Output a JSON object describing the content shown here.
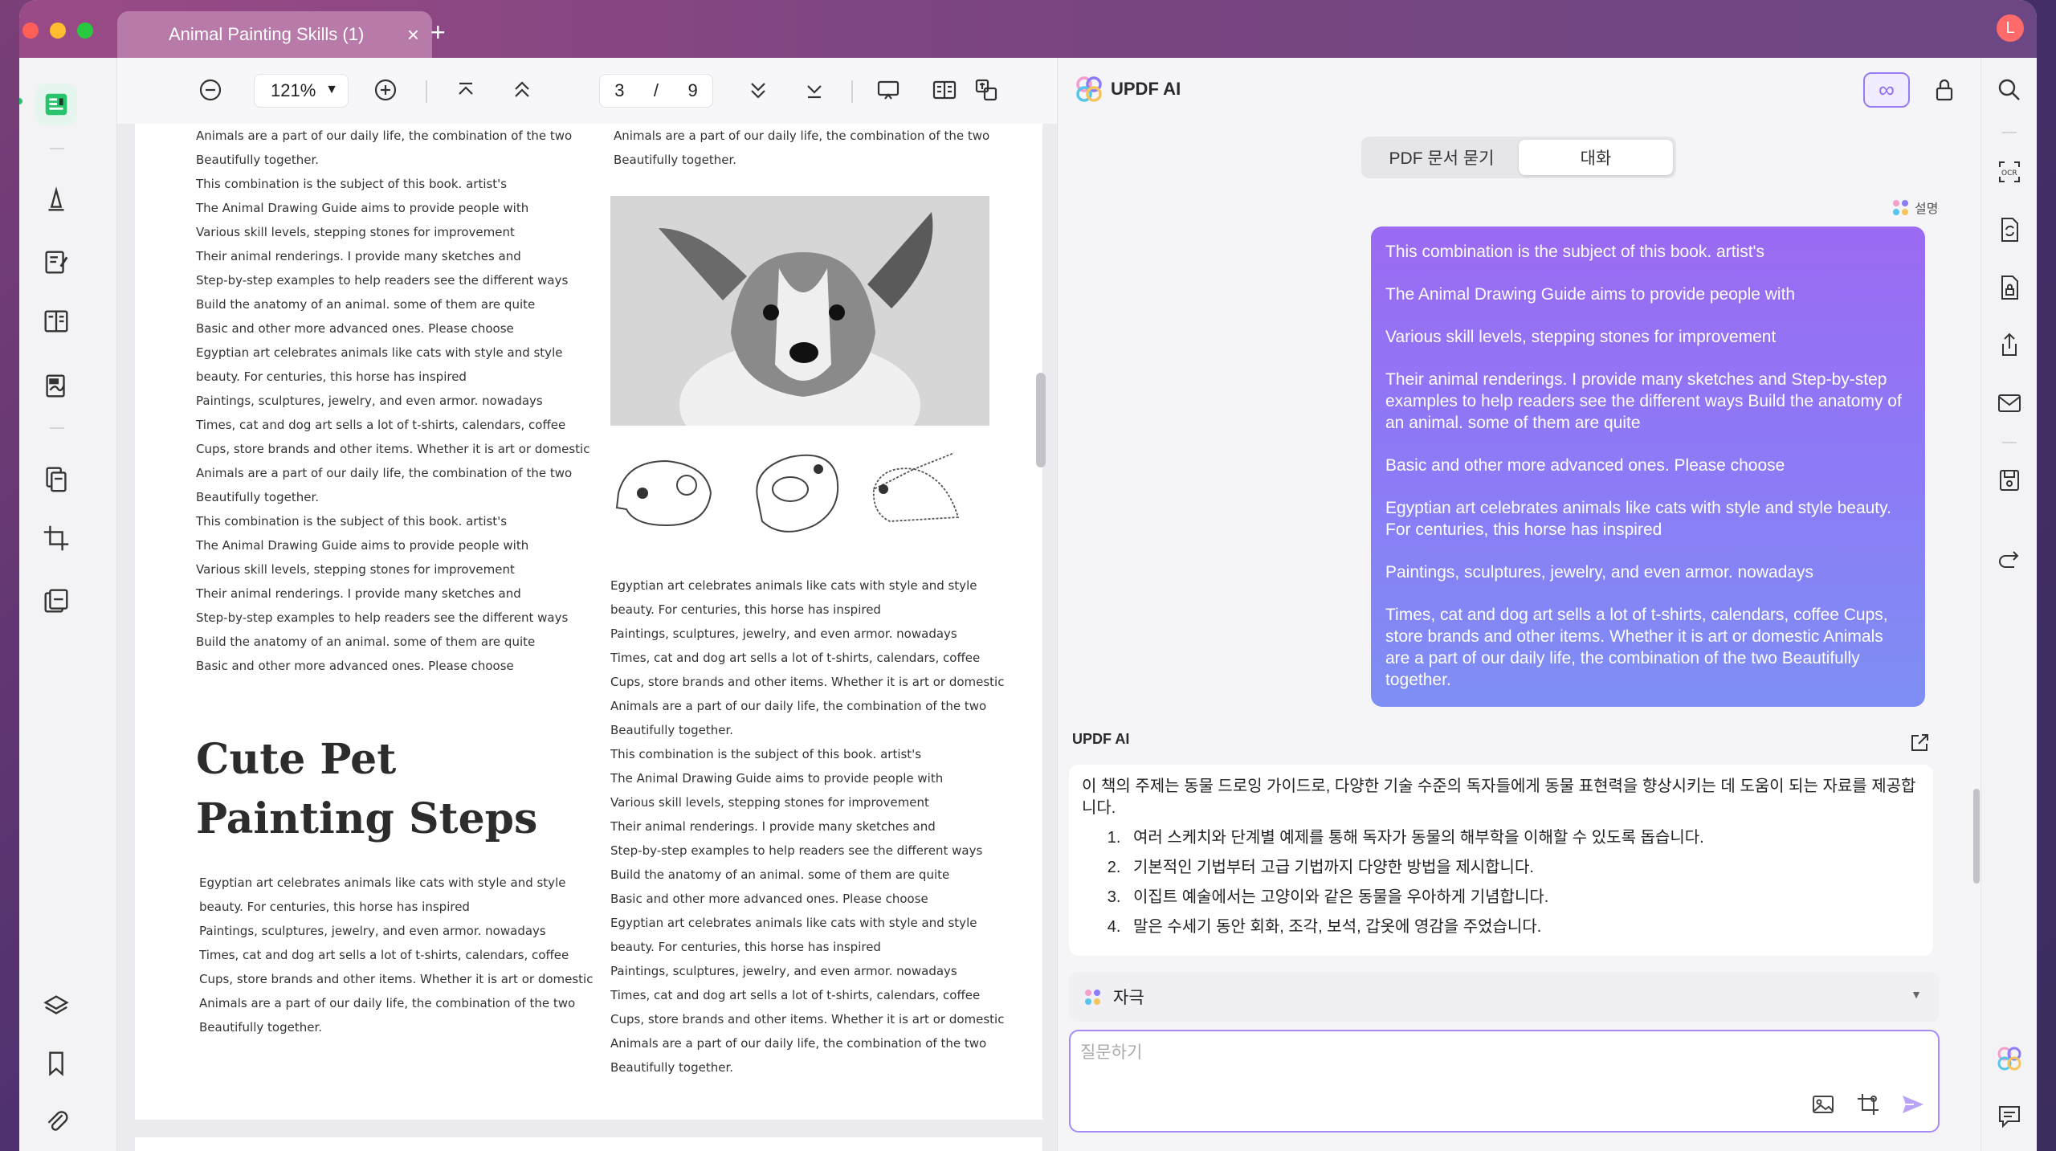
{
  "window": {
    "tab_title": "Animal Painting Skills (1)",
    "profile_initial": "L"
  },
  "toolbar": {
    "zoom": "121%",
    "current_page": "3",
    "page_separator": "/",
    "total_pages": "9"
  },
  "pdf": {
    "left_column_top": [
      "Animals are a part of our daily life, the combination of the two",
      "Beautifully together.",
      "This combination is the subject of this book. artist's",
      "The Animal Drawing Guide aims to provide people with",
      "Various skill levels, stepping stones for improvement",
      "Their animal renderings. I provide many sketches and",
      "Step-by-step examples to help readers see the different ways",
      "Build the anatomy of an animal. some of them are quite",
      "Basic and other more advanced ones. Please choose",
      "Egyptian art celebrates animals like cats with style and style",
      "beauty. For centuries, this horse has inspired",
      "Paintings, sculptures, jewelry, and even armor. nowadays",
      "Times, cat and dog art sells a lot of t-shirts, calendars, coffee",
      "Cups, store brands and other items. Whether it is art or domestic",
      "Animals are a part of our daily life, the combination of the two",
      "Beautifully together.",
      "This combination is the subject of this book. artist's",
      "The Animal Drawing Guide aims to provide people with",
      "Various skill levels, stepping stones for improvement",
      "Their animal renderings. I provide many sketches and",
      "Step-by-step examples to help readers see the different ways",
      "Build the anatomy of an animal. some of them are quite",
      "Basic and other more advanced ones. Please choose"
    ],
    "heading": "Cute Pet Painting Steps",
    "left_column_bottom": [
      "Egyptian art celebrates animals like cats with style and style",
      "beauty. For centuries, this horse has inspired",
      "Paintings, sculptures, jewelry, and even armor. nowadays",
      "Times, cat and dog art sells a lot of t-shirts, calendars, coffee",
      "Cups, store brands and other items. Whether it is art or domestic",
      "Animals are a part of our daily life, the combination of the two",
      "Beautifully together."
    ],
    "right_column_top": [
      "Animals are a part of our daily life, the combination of the two",
      "Beautifully together."
    ],
    "right_column_bottom": [
      "Egyptian art celebrates animals like cats with style and style",
      "beauty. For centuries, this horse has inspired",
      "Paintings, sculptures, jewelry, and even armor. nowadays",
      "Times, cat and dog art sells a lot of t-shirts, calendars, coffee",
      "Cups, store brands and other items. Whether it is art or domestic",
      "Animals are a part of our daily life, the combination of the two",
      "Beautifully together.",
      "This combination is the subject of this book. artist's",
      "The Animal Drawing Guide aims to provide people with",
      "Various skill levels, stepping stones for improvement",
      "Their animal renderings. I provide many sketches and",
      "Step-by-step examples to help readers see the different ways",
      "Build the anatomy of an animal. some of them are quite",
      "Basic and other more advanced ones. Please choose",
      "Egyptian art celebrates animals like cats with style and style",
      "beauty. For centuries, this horse has inspired",
      "Paintings, sculptures, jewelry, and even armor. nowadays",
      "Times, cat and dog art sells a lot of t-shirts, calendars, coffee",
      "Cups, store brands and other items. Whether it is art or domestic",
      "Animals are a part of our daily life, the combination of the two",
      "Beautifully together."
    ]
  },
  "ai": {
    "title": "UPDF AI",
    "mode_tabs": [
      "PDF 문서 묻기",
      "대화"
    ],
    "active_mode": 1,
    "explain_tag": "설명",
    "user_message": [
      "This combination is the subject of this book. artist's",
      "The Animal Drawing Guide aims to provide people with",
      "Various skill levels, stepping stones for improvement",
      "Their animal renderings. I provide many sketches and Step-by-step examples to help readers see the different ways Build the anatomy of an animal. some of them are quite",
      "Basic and other more advanced ones. Please choose",
      "Egyptian art celebrates animals like cats with style and style beauty. For centuries, this horse has inspired",
      "Paintings, sculptures, jewelry, and even armor. nowadays",
      "Times, cat and dog art sells a lot of t-shirts, calendars, coffee Cups, store brands and other items. Whether it is art or domestic Animals are a part of our daily life, the combination of the two Beautifully together."
    ],
    "answer_label": "UPDF AI",
    "answer_intro": "이 책의 주제는 동물 드로잉 가이드로, 다양한 기술 수준의 독자들에게 동물 표현력을 향상시키는 데 도움이 되는 자료를 제공합니다.",
    "answer_items": [
      "여러 스케치와 단계별 예제를 통해 독자가 동물의 해부학을 이해할 수 있도록 돕습니다.",
      "기본적인 기법부터 고급 기법까지 다양한 방법을 제시합니다.",
      "이집트 예술에서는 고양이와 같은 동물을 우아하게 기념합니다.",
      "말은 수세기 동안 회화, 조각, 보석, 갑옷에 영감을 주었습니다."
    ],
    "prompt_selected": "자극",
    "input_placeholder": "질문하기"
  },
  "colors": {
    "accent": "#8f6cf0",
    "rail_active": "#27c46d",
    "bubble_top": "#9b6af2",
    "bubble_bottom": "#7e8ff4"
  },
  "icons": {
    "rail": [
      "reader-icon",
      "highlight-icon",
      "edit-text-icon",
      "page-layout-icon",
      "fill-sign-icon",
      "organize-pages-icon",
      "crop-icon",
      "compare-icon",
      "layers-icon",
      "bookmark-icon",
      "attachment-icon"
    ],
    "right": [
      "search-icon",
      "ocr-icon",
      "convert-icon",
      "protect-icon",
      "share-icon",
      "email-icon",
      "save-icon",
      "undo-icon",
      "updf-ai-icon",
      "comment-icon"
    ]
  }
}
